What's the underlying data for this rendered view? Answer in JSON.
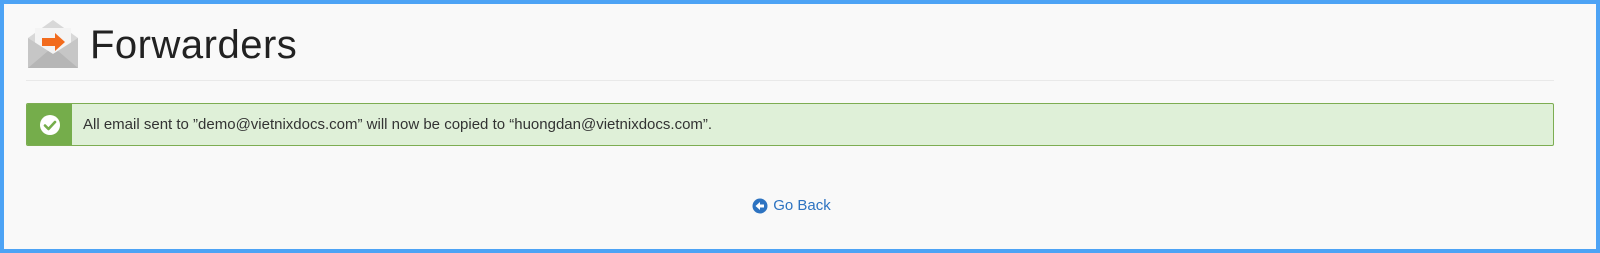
{
  "page": {
    "title": "Forwarders",
    "icon": "email-forward-icon"
  },
  "alert": {
    "type": "success",
    "icon": "check-circle-icon",
    "message": "All email sent to ”demo@vietnixdocs.com” will now be copied to “huongdan@vietnixdocs.com”."
  },
  "actions": {
    "go_back_label": "Go Back",
    "go_back_icon": "arrow-left-circle-icon"
  },
  "colors": {
    "frame_border": "#4da3f5",
    "alert_background": "#dff0d8",
    "alert_accent": "#75ad4b",
    "link": "#2d73c1",
    "icon_orange": "#f26b1d"
  }
}
